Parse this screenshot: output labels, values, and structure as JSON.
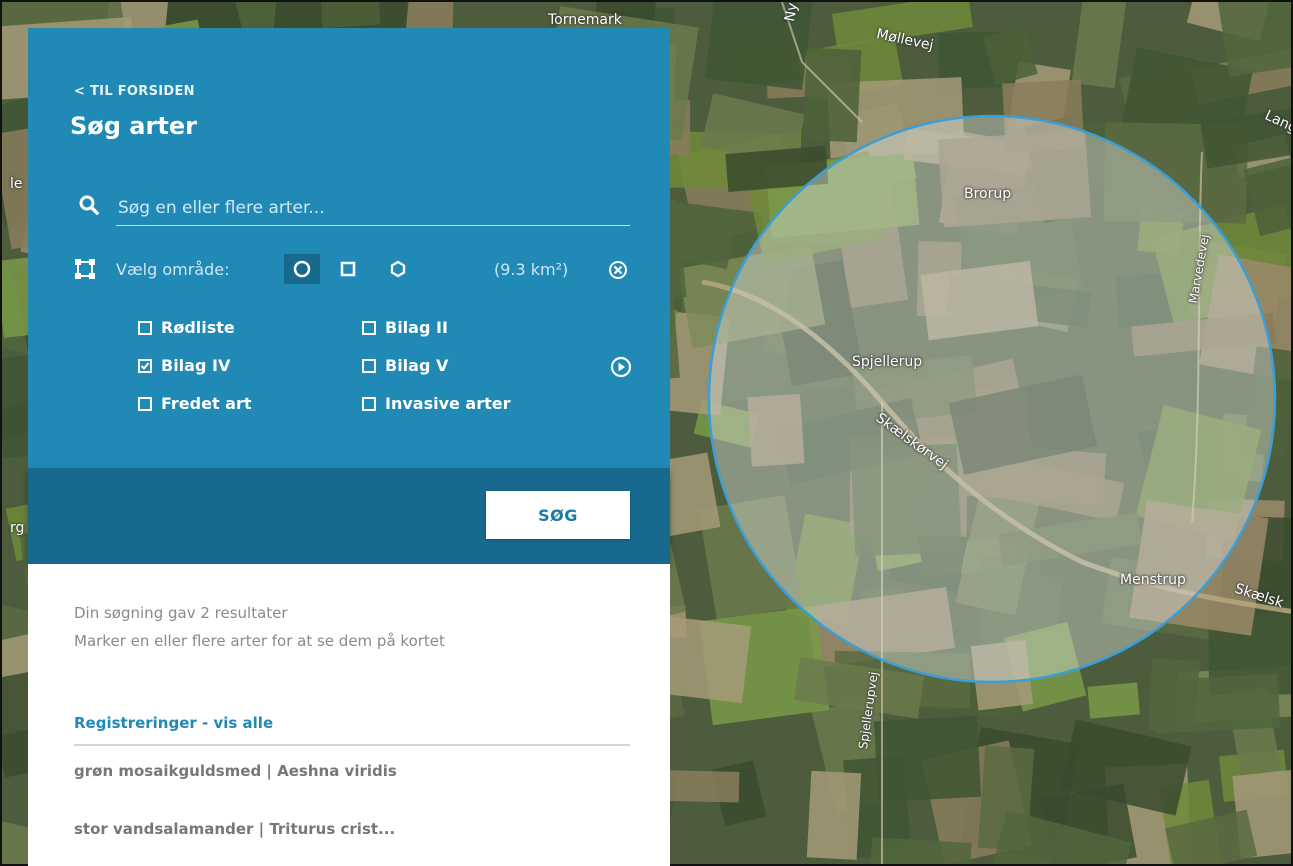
{
  "panel": {
    "back_link": "< TIL FORSIDEN",
    "title": "Søg arter",
    "search": {
      "placeholder": "Søg en eller flere arter..."
    },
    "area": {
      "label": "Vælg område:",
      "shapes": [
        "circle",
        "square",
        "hexagon"
      ],
      "active_shape": "circle",
      "value": "(9.3 km²)"
    },
    "filters": [
      {
        "label": "Rødliste",
        "checked": false
      },
      {
        "label": "Bilag II",
        "checked": false
      },
      {
        "label": "Bilag IV",
        "checked": true
      },
      {
        "label": "Bilag V",
        "checked": false
      },
      {
        "label": "Fredet art",
        "checked": false
      },
      {
        "label": "Invasive arter",
        "checked": false
      }
    ],
    "search_button": "SØG"
  },
  "results": {
    "summary": "Din søgning gav 2 resultater",
    "hint": "Marker en eller flere arter for at se dem på kortet",
    "registrations_link": "Registreringer - vis alle",
    "species": [
      "grøn mosaikguldsmed | Aeshna viridis",
      "stor vandsalamander | Triturus crist..."
    ]
  },
  "map": {
    "labels": {
      "tornemark": "Tornemark",
      "nyv": "Nyv",
      "mollevej": "Møllevej",
      "lang": "Lang",
      "le": "le",
      "rg": "rg",
      "brorup": "Brorup",
      "marvedevej": "Marvedevej",
      "spjellerup": "Spjellerup",
      "skaelskorvej": "Skælskørvej",
      "menstrup": "Menstrup",
      "skaelsk": "Skælsk",
      "spjellerupvej": "Spjellerupvej"
    }
  },
  "colors": {
    "panel_blue": "#2089b6",
    "panel_dark": "#176a8e",
    "circle_stroke": "#3a9fd6"
  }
}
